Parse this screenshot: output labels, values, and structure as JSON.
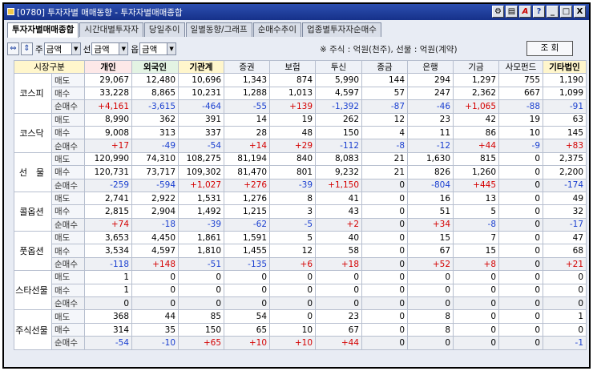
{
  "window": {
    "title": "[0780] 투자자별 매매동향 - 투자자별매매종합",
    "buttons": [
      "⚙",
      "▤",
      "A",
      "?",
      "_",
      "□",
      "X"
    ]
  },
  "tabs": [
    {
      "label": "투자자별매매종합",
      "active": true
    },
    {
      "label": "시간대별투자자",
      "active": false
    },
    {
      "label": "당일추이",
      "active": false
    },
    {
      "label": "일별동향/그래프",
      "active": false
    },
    {
      "label": "순매수추이",
      "active": false
    },
    {
      "label": "업종별투자자순매수",
      "active": false
    }
  ],
  "toolbar": {
    "arrow_lr": "⇔",
    "arrow_ud": "⇕",
    "label_ju": "주",
    "label_seon": "선",
    "label_op": "옵",
    "select_ju": "금액",
    "select_seon": "금액",
    "select_op": "금액",
    "unit_note": "※ 주식 : 억원(천주), 선물 : 억원(계약)",
    "query_label": "조 회"
  },
  "table": {
    "header_market": "시장구분",
    "columns": [
      "개인",
      "외국인",
      "기관계",
      "증권",
      "보험",
      "투신",
      "종금",
      "은행",
      "기금",
      "사모펀드",
      "기타법인"
    ],
    "groups": [
      {
        "market": "코스피",
        "rows": [
          {
            "label": "매도",
            "values": [
              "29,067",
              "12,480",
              "10,696",
              "1,343",
              "874",
              "5,990",
              "144",
              "294",
              "1,297",
              "755",
              "1,190"
            ]
          },
          {
            "label": "매수",
            "values": [
              "33,228",
              "8,865",
              "10,231",
              "1,288",
              "1,013",
              "4,597",
              "57",
              "247",
              "2,362",
              "667",
              "1,099"
            ]
          },
          {
            "label": "순매수",
            "values": [
              "+4,161",
              "-3,615",
              "-464",
              "-55",
              "+139",
              "-1,392",
              "-87",
              "-46",
              "+1,065",
              "-88",
              "-91"
            ]
          }
        ]
      },
      {
        "market": "코스닥",
        "rows": [
          {
            "label": "매도",
            "values": [
              "8,990",
              "362",
              "391",
              "14",
              "19",
              "262",
              "12",
              "23",
              "42",
              "19",
              "63"
            ]
          },
          {
            "label": "매수",
            "values": [
              "9,008",
              "313",
              "337",
              "28",
              "48",
              "150",
              "4",
              "11",
              "86",
              "10",
              "145"
            ]
          },
          {
            "label": "순매수",
            "values": [
              "+17",
              "-49",
              "-54",
              "+14",
              "+29",
              "-112",
              "-8",
              "-12",
              "+44",
              "-9",
              "+83"
            ]
          }
        ]
      },
      {
        "market": "선　물",
        "rows": [
          {
            "label": "매도",
            "values": [
              "120,990",
              "74,310",
              "108,275",
              "81,194",
              "840",
              "8,083",
              "21",
              "1,630",
              "815",
              "0",
              "2,375"
            ]
          },
          {
            "label": "매수",
            "values": [
              "120,731",
              "73,717",
              "109,302",
              "81,470",
              "801",
              "9,232",
              "21",
              "826",
              "1,260",
              "0",
              "2,200"
            ]
          },
          {
            "label": "순매수",
            "values": [
              "-259",
              "-594",
              "+1,027",
              "+276",
              "-39",
              "+1,150",
              "0",
              "-804",
              "+445",
              "0",
              "-174"
            ]
          }
        ]
      },
      {
        "market": "콜옵션",
        "rows": [
          {
            "label": "매도",
            "values": [
              "2,741",
              "2,922",
              "1,531",
              "1,276",
              "8",
              "41",
              "0",
              "16",
              "13",
              "0",
              "49"
            ]
          },
          {
            "label": "매수",
            "values": [
              "2,815",
              "2,904",
              "1,492",
              "1,215",
              "3",
              "43",
              "0",
              "51",
              "5",
              "0",
              "32"
            ]
          },
          {
            "label": "순매수",
            "values": [
              "+74",
              "-18",
              "-39",
              "-62",
              "-5",
              "+2",
              "0",
              "+34",
              "-8",
              "0",
              "-17"
            ]
          }
        ]
      },
      {
        "market": "풋옵션",
        "rows": [
          {
            "label": "매도",
            "values": [
              "3,653",
              "4,450",
              "1,861",
              "1,591",
              "5",
              "40",
              "0",
              "15",
              "7",
              "0",
              "47"
            ]
          },
          {
            "label": "매수",
            "values": [
              "3,534",
              "4,597",
              "1,810",
              "1,455",
              "12",
              "58",
              "0",
              "67",
              "15",
              "0",
              "68"
            ]
          },
          {
            "label": "순매수",
            "values": [
              "-118",
              "+148",
              "-51",
              "-135",
              "+6",
              "+18",
              "0",
              "+52",
              "+8",
              "0",
              "+21"
            ]
          }
        ]
      },
      {
        "market": "스타선물",
        "rows": [
          {
            "label": "매도",
            "values": [
              "1",
              "0",
              "0",
              "0",
              "0",
              "0",
              "0",
              "0",
              "0",
              "0",
              "0"
            ]
          },
          {
            "label": "매수",
            "values": [
              "1",
              "0",
              "0",
              "0",
              "0",
              "0",
              "0",
              "0",
              "0",
              "0",
              "0"
            ]
          },
          {
            "label": "순매수",
            "values": [
              "0",
              "0",
              "0",
              "0",
              "0",
              "0",
              "0",
              "0",
              "0",
              "0",
              "0"
            ]
          }
        ]
      },
      {
        "market": "주식선물",
        "rows": [
          {
            "label": "매도",
            "values": [
              "368",
              "44",
              "85",
              "54",
              "0",
              "23",
              "0",
              "8",
              "0",
              "0",
              "1"
            ]
          },
          {
            "label": "매수",
            "values": [
              "314",
              "35",
              "150",
              "65",
              "10",
              "67",
              "0",
              "8",
              "0",
              "0",
              "0"
            ]
          },
          {
            "label": "순매수",
            "values": [
              "-54",
              "-10",
              "+65",
              "+10",
              "+10",
              "+44",
              "0",
              "0",
              "0",
              "0",
              "-1"
            ]
          }
        ]
      }
    ]
  },
  "colors": {
    "positive": "#d40000",
    "negative": "#1a3fd0",
    "title_bar": "#1f3f9e"
  }
}
